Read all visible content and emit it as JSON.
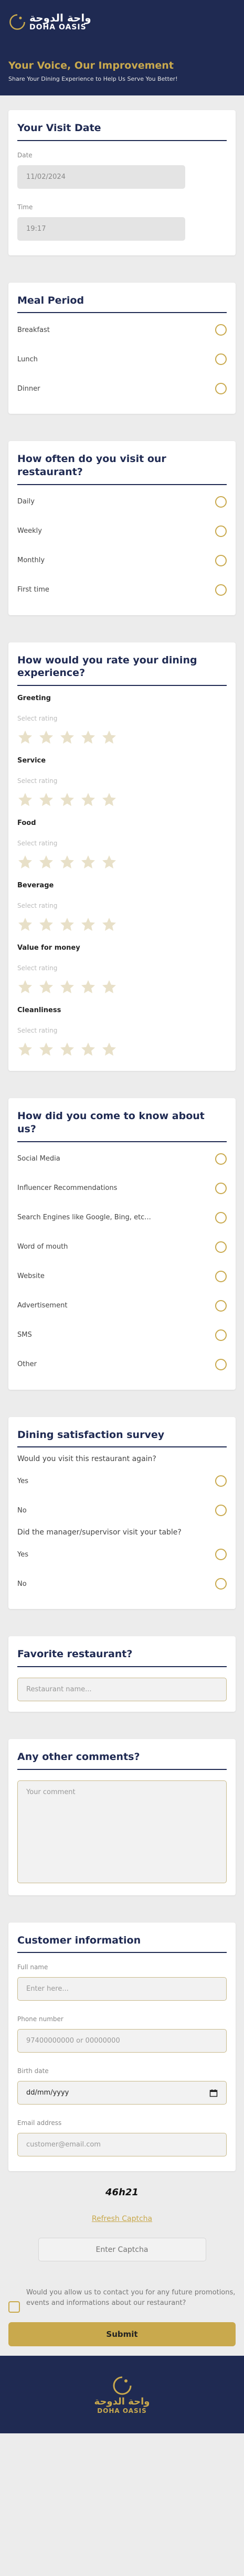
{
  "header": {
    "logo_ar": "واحة الدوحة",
    "logo_en": "DOHA OASIS",
    "title": "Your Voice, Our Improvement",
    "subtitle": "Share Your Dining Experience to Help Us Serve You Better!"
  },
  "visit": {
    "title": "Your Visit Date",
    "date_label": "Date",
    "date_value": "11/02/2024",
    "time_label": "Time",
    "time_value": "19:17"
  },
  "meal": {
    "title": "Meal Period",
    "options": [
      "Breakfast",
      "Lunch",
      "Dinner"
    ]
  },
  "frequency": {
    "title": "How often do you visit our restaurant?",
    "options": [
      "Daily",
      "Weekly",
      "Monthly",
      "First time"
    ]
  },
  "rating": {
    "title": "How would you rate your dining experience?",
    "hint": "Select rating",
    "star_count": 5,
    "star_color": "#e8e0c8",
    "categories": [
      "Greeting",
      "Service",
      "Food",
      "Beverage",
      "Value for money",
      "Cleanliness"
    ]
  },
  "source": {
    "title": "How did you come to know about us?",
    "options": [
      "Social Media",
      "Influencer Recommendations",
      "Search Engines like Google, Bing, etc...",
      "Word of mouth",
      "Website",
      "Advertisement",
      "SMS",
      "Other"
    ]
  },
  "survey": {
    "title": "Dining satisfaction survey",
    "q1": "Would you visit this restaurant again?",
    "q1_options": [
      "Yes",
      "No"
    ],
    "q2": "Did the manager/supervisor visit your table?",
    "q2_options": [
      "Yes",
      "No"
    ]
  },
  "favorite": {
    "title": "Favorite restaurant?",
    "placeholder": "Restaurant name..."
  },
  "comments": {
    "title": "Any other comments?",
    "placeholder": "Your comment"
  },
  "customer": {
    "title": "Customer information",
    "name_label": "Full name",
    "name_placeholder": "Enter here...",
    "phone_label": "Phone number",
    "phone_placeholder": "97400000000 or 00000000",
    "birth_label": "Birth date",
    "birth_placeholder": "dd/mm/yyyy",
    "email_label": "Email address",
    "email_placeholder": "customer@email.com"
  },
  "captcha": {
    "code": "46h21",
    "refresh_label": "Refresh Captcha",
    "placeholder": "Enter Captcha"
  },
  "consent": {
    "text": "Would you allow us to contact you for any future promotions, events and informations about our restaurant?"
  },
  "submit_label": "Submit",
  "colors": {
    "navy": "#1f2a52",
    "gold": "#c9a94d"
  }
}
